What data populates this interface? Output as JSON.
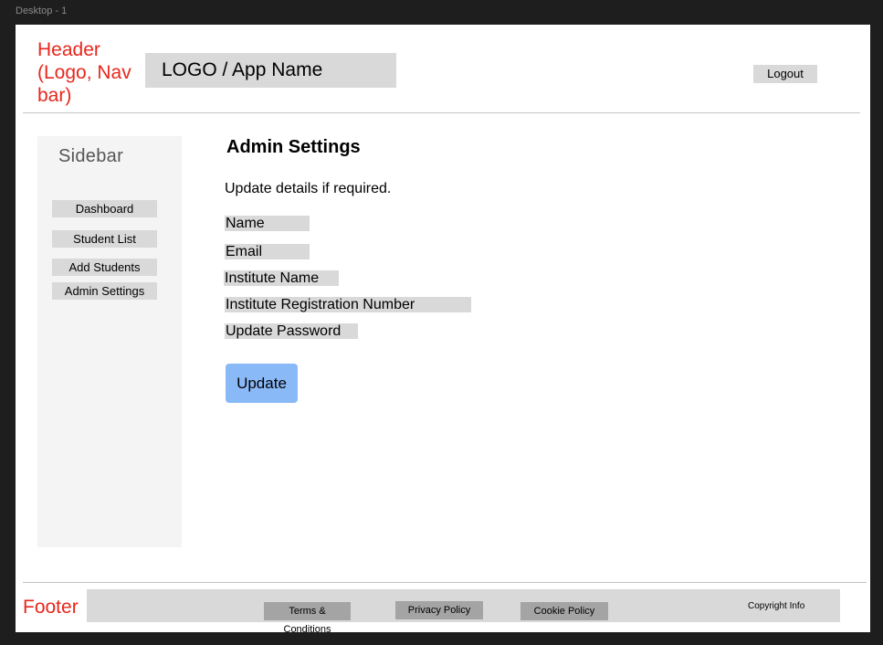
{
  "canvas": {
    "frame_label": "Desktop - 1"
  },
  "header": {
    "annotation": "Header (Logo, Nav bar)",
    "logo_text": "LOGO / App Name",
    "logout_label": "Logout"
  },
  "sidebar": {
    "title": "Sidebar",
    "items": [
      {
        "label": "Dashboard"
      },
      {
        "label": "Student List"
      },
      {
        "label": "Add Students"
      },
      {
        "label": "Admin Settings"
      }
    ]
  },
  "main": {
    "title": "Admin Settings",
    "subtitle": "Update details if required.",
    "fields": [
      {
        "label": "Name"
      },
      {
        "label": "Email"
      },
      {
        "label": "Institute Name"
      },
      {
        "label": "Institute Registration Number"
      },
      {
        "label": "Update Password"
      }
    ],
    "update_label": "Update"
  },
  "footer": {
    "annotation": "Footer",
    "links": [
      {
        "label": "Terms & Conditions"
      },
      {
        "label": "Privacy Policy"
      },
      {
        "label": "Cookie Policy"
      }
    ],
    "copyright": "Copyright Info"
  },
  "colors": {
    "annotation_red": "#e8271c",
    "placeholder_gray": "#d9d9d9",
    "sidebar_bg": "#f5f4f4",
    "button_blue": "#8ab9f8",
    "footer_link_gray": "#a4a4a4"
  }
}
